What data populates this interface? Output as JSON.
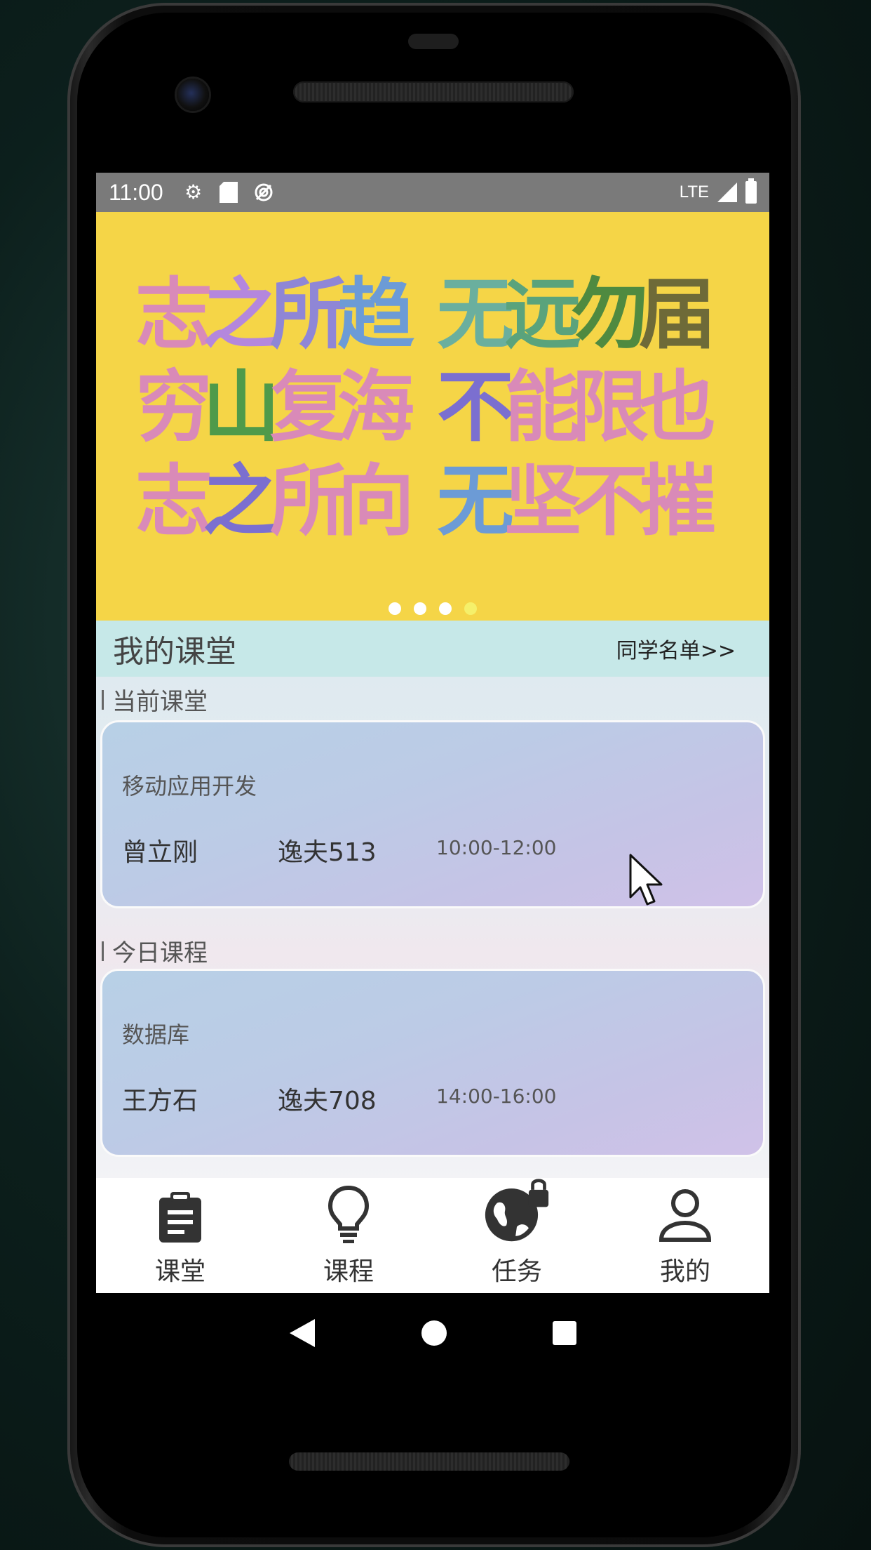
{
  "status_bar": {
    "time": "11:00",
    "network": "LTE",
    "icons": [
      "gear-icon",
      "sd-card-icon",
      "sync-icon",
      "signal-icon",
      "battery-icon"
    ]
  },
  "banner": {
    "lines": [
      [
        "志",
        "之",
        "所",
        "趋",
        "无",
        "远",
        "勿",
        "届"
      ],
      [
        "穷",
        "山",
        "复",
        "海",
        "不",
        "能",
        "限",
        "也"
      ],
      [
        "志",
        "之",
        "所",
        "向",
        "无",
        "坚",
        "不",
        "摧"
      ]
    ],
    "colors": [
      [
        "#d98ab8",
        "#b487dd",
        "#8f86d6",
        "#6c9bd6",
        "#6aaf9e",
        "#5aa37c",
        "#4f8a40",
        "#6e6a38"
      ],
      [
        "#d98ab8",
        "#4f9a4a",
        "#d98ab8",
        "#d98ab8",
        "#7b6fd0",
        "#d98ab8",
        "#d98ab8",
        "#d98ab8"
      ],
      [
        "#d98ab8",
        "#7b6fd0",
        "#d98ab8",
        "#d98ab8",
        "#6c9bd6",
        "#d98ab8",
        "#d98ab8",
        "#d98ab8"
      ]
    ],
    "page_count": 4,
    "active_page": 4
  },
  "my_class": {
    "title": "我的课堂",
    "classmates_link": "同学名单>>"
  },
  "current_class": {
    "label": "当前课堂",
    "course": "移动应用开发",
    "teacher": "曾立刚",
    "room": "逸夫513",
    "time": "10:00-12:00"
  },
  "today_course": {
    "label": "今日课程",
    "course": "数据库",
    "teacher": "王方石",
    "room": "逸夫708",
    "time": "14:00-16:00"
  },
  "bottom_nav": [
    {
      "label": "课堂",
      "icon": "clipboard-icon"
    },
    {
      "label": "课程",
      "icon": "lightbulb-icon"
    },
    {
      "label": "任务",
      "icon": "globe-lock-icon"
    },
    {
      "label": "我的",
      "icon": "person-icon"
    }
  ],
  "system_nav": [
    "back-icon",
    "home-icon",
    "recents-icon"
  ]
}
